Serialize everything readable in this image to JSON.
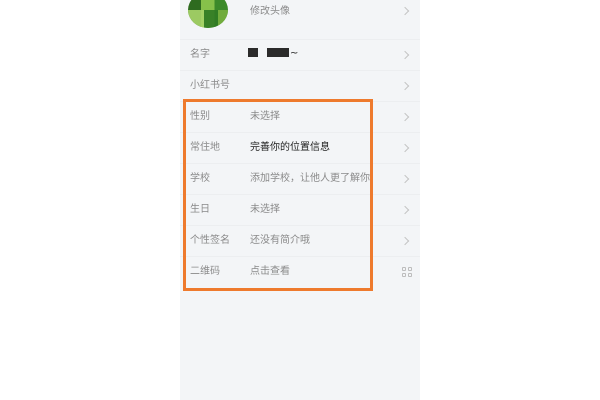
{
  "profile": {
    "avatar_label": "修改头像",
    "rows": [
      {
        "label": "名字",
        "value": "~"
      },
      {
        "label": "小红书号",
        "value": ""
      },
      {
        "label": "性别",
        "value": "未选择"
      },
      {
        "label": "常住地",
        "value": "完善你的位置信息"
      },
      {
        "label": "学校",
        "value": "添加学校，让他人更了解你"
      },
      {
        "label": "生日",
        "value": "未选择"
      },
      {
        "label": "个性签名",
        "value": "还没有简介哦"
      },
      {
        "label": "二维码",
        "value": "点击查看"
      }
    ]
  },
  "colors": {
    "highlight_border": "#ee7a2d",
    "page_background": "#f3f5f7",
    "label_text": "#8a8a8a",
    "strong_text": "#222222"
  },
  "icons": {
    "chevron": "chevron-right-icon",
    "qrcode": "qrcode-icon"
  }
}
